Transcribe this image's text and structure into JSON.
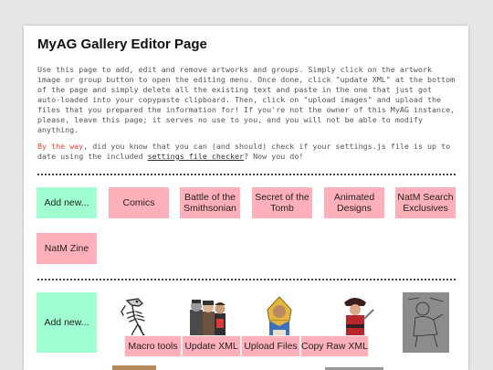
{
  "header": {
    "title": "MyAG Gallery Editor Page"
  },
  "intro": {
    "text": "Use this page to add, edit and remove artworks and groups. Simply click on the artwork image or group button to open the editing menu. Once done, click \"update XML\" at the bottom of the page and simply delete all the existing text and paste in the one that just got auto-loaded into your copypaste clipboard. Then, click on \"upload images\" and upload the files that you prepared the information for! If you're not the owner of this MyAG instance, please, leave this page; it serves no use to you, and you will not be able to modify anything."
  },
  "tip": {
    "lead": "By the way",
    "text1": ", did you know that you can (and should) check if your settings.js file is up to date using the included ",
    "link": "settings file checker",
    "text2": "? Now you do!"
  },
  "groups": {
    "add_label": "Add new...",
    "items": [
      "Comics",
      "Battle of the Smithsonian",
      "Secret of the Tomb",
      "Animated Designs",
      "NatM Search Exclusives",
      "NatM Zine"
    ]
  },
  "artworks": {
    "add_label": "Add new...",
    "items": [
      {
        "name": "dinosaur-skeleton-artwork"
      },
      {
        "name": "characters-group-artwork"
      },
      {
        "name": "pharaoh-artwork"
      },
      {
        "name": "pirate-artwork"
      },
      {
        "name": "pencil-sketch-artwork"
      }
    ]
  },
  "toolbar": {
    "macro": "Macro tools",
    "update": "Update XML",
    "upload": "Upload Files",
    "copy": "Copy Raw XML"
  },
  "colors": {
    "group_button": "#ffb0bb",
    "add_button": "#9fffd0",
    "tip_accent": "#e0443c"
  }
}
